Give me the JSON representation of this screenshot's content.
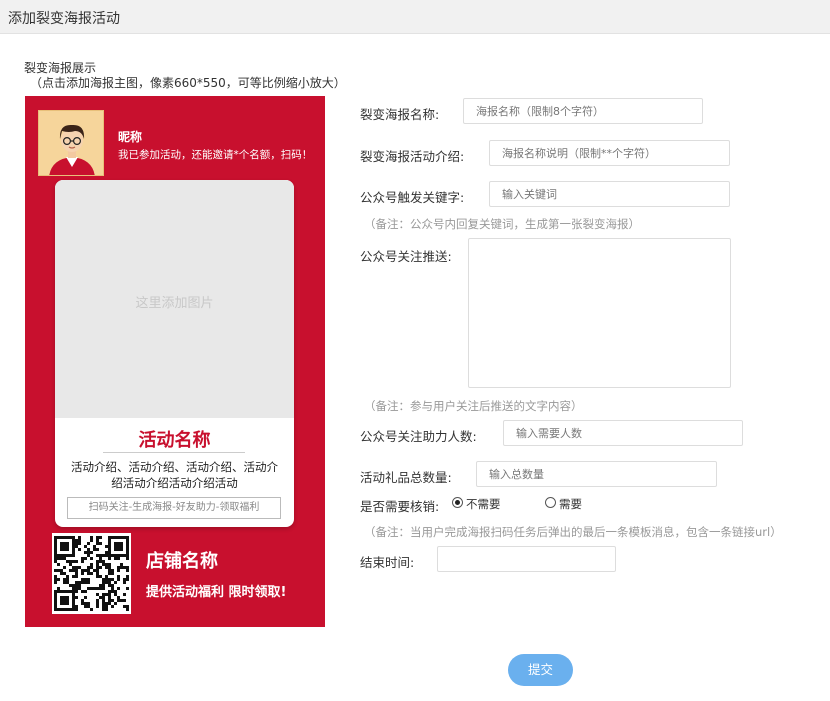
{
  "header": {
    "title": "添加裂变海报活动"
  },
  "preview": {
    "title": "裂变海报展示",
    "hint": "（点击添加海报主图，像素660*550，可等比例缩小放大）"
  },
  "poster": {
    "nickname": "昵称",
    "invite_text": "我已参加活动，还能邀请*个名额，扫码！",
    "image_placeholder": "这里添加图片",
    "activity_name": "活动名称",
    "activity_intro": "活动介绍、活动介绍、活动介绍、活动介绍活动介绍活动介绍活动",
    "scan_hint": "扫码关注-生成海报-好友助力-领取福利",
    "store_name": "店铺名称",
    "store_benefit": "提供活动福利 限时领取!"
  },
  "form": {
    "poster_name": {
      "label": "裂变海报名称:",
      "placeholder": "海报名称（限制8个字符）"
    },
    "activity_intro": {
      "label": "裂变海报活动介绍:",
      "placeholder": "海报名称说明（限制**个字符）"
    },
    "keyword": {
      "label": "公众号触发关键字:",
      "placeholder": "输入关键词",
      "note": "（备注：公众号内回复关键词，生成第一张裂变海报）"
    },
    "follow_push": {
      "label": "公众号关注推送:",
      "note": "（备注：参与用户关注后推送的文字内容）"
    },
    "helpers": {
      "label": "公众号关注助力人数:",
      "placeholder": "输入需要人数"
    },
    "gift_total": {
      "label": "活动礼品总数量:",
      "placeholder": "输入总数量"
    },
    "verify": {
      "label": "是否需要核销:",
      "options": [
        "不需要",
        "需要"
      ],
      "selected": "不需要",
      "note": "（备注：当用户完成海报扫码任务后弹出的最后一条模板消息，包含一条链接url）"
    },
    "end_time": {
      "label": "结束时间:",
      "value": ""
    },
    "submit_label": "提交"
  },
  "colors": {
    "poster_red": "#c8102e",
    "submit_blue": "#6ab0ee"
  }
}
